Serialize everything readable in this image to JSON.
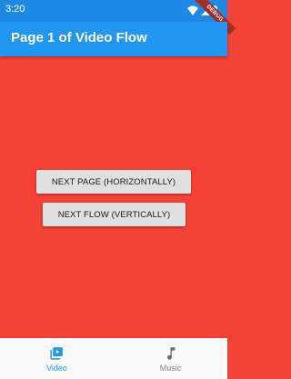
{
  "status_bar": {
    "time": "3:20",
    "icons": [
      "wifi-icon",
      "signal-icon",
      "battery-icon"
    ]
  },
  "debug_banner": {
    "label": "DEBUG"
  },
  "app_bar": {
    "title": "Page 1 of Video Flow",
    "color": "#2196f3"
  },
  "content": {
    "background_color": "#f44336",
    "buttons": {
      "next_page_label": "NEXT PAGE (HORIZONTALLY)",
      "next_flow_label": "NEXT FLOW (VERTICALLY)"
    }
  },
  "bottom_nav": {
    "items": [
      {
        "label": "Video",
        "icon": "video-library-icon",
        "selected": true,
        "color": "#2196f3"
      },
      {
        "label": "Music",
        "icon": "music-note-icon",
        "selected": false,
        "color": "#808080"
      }
    ]
  }
}
